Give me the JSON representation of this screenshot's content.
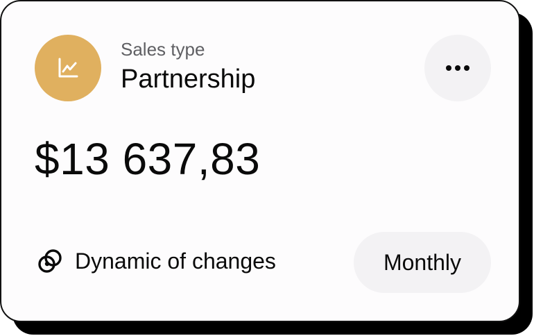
{
  "card": {
    "icon": "chart-line-icon",
    "subtitle": "Sales type",
    "title": "Partnership",
    "amount": "$13 637,83",
    "more_icon": "more-horizontal-icon",
    "dynamic": {
      "icon": "dynamic-changes-icon",
      "label": "Dynamic of changes"
    },
    "period": "Monthly"
  },
  "colors": {
    "accent": "#e0b05f",
    "button_bg": "#f3f2f4",
    "card_bg": "#fdfcfd",
    "text": "#0a0a0a",
    "muted_text": "#5f5f63"
  }
}
